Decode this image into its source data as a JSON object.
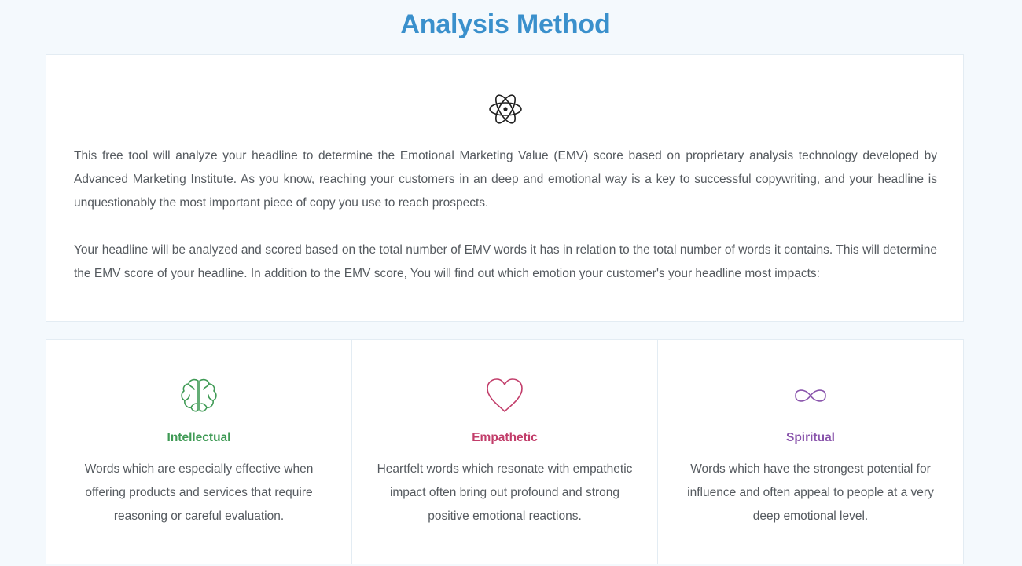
{
  "page": {
    "title": "Analysis Method"
  },
  "intro": {
    "icon": "atom-icon",
    "paragraph1": "This free tool will analyze your headline to determine the Emotional Marketing Value (EMV) score based on proprietary analysis technology developed by Advanced Marketing Institute. As you know, reaching your customers in an deep and emotional way is a key to successful copywriting, and your headline is unquestionably the most important piece of copy you use to reach prospects.",
    "paragraph2": "Your headline will be analyzed and scored based on the total number of EMV words it has in relation to the total number of words it contains. This will determine the EMV score of your headline.  In addition to the EMV score, You will find out which emotion your customer's your headline most impacts:"
  },
  "features": [
    {
      "icon": "brain-icon",
      "title": "Intellectual",
      "description": "Words which are especially effective when offering products and services that require reasoning or careful evaluation.",
      "color": "#3f9a55"
    },
    {
      "icon": "heart-icon",
      "title": "Empathetic",
      "description": "Heartfelt words which resonate with empathetic impact often bring out profound and strong positive emotional reactions.",
      "color": "#c23d6a"
    },
    {
      "icon": "infinity-icon",
      "title": "Spiritual",
      "description": "Words which have the strongest potential for influence and often appeal to people at a very deep emotional level.",
      "color": "#8a55ac"
    }
  ]
}
